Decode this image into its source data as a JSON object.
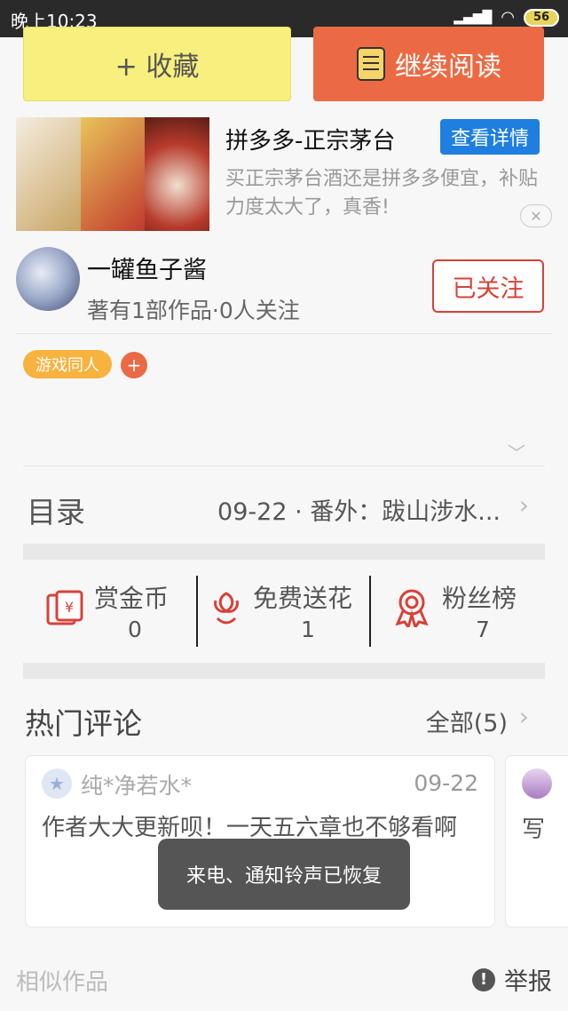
{
  "status_bar": {
    "time": "晚上10:23",
    "battery": "56"
  },
  "actions": {
    "favorite_label": "+ 收藏",
    "read_label": "继续阅读"
  },
  "ad": {
    "title": "拼多多-正宗茅台",
    "button": "查看详情",
    "description": "买正宗茅台酒还是拼多多便宜，补贴力度太大了，真香!",
    "close": "✕"
  },
  "author": {
    "name": "一罐鱼子酱",
    "meta": "著有1部作品·0人关注",
    "follow_label": "已关注"
  },
  "tags": {
    "items": [
      "游戏同人"
    ],
    "add": "+"
  },
  "toc": {
    "label": "目录",
    "latest": "09-22 · 番外：跋山涉水..."
  },
  "stats": [
    {
      "label": "赏金币",
      "value": "0",
      "icon": "coin-icon"
    },
    {
      "label": "免费送花",
      "value": "1",
      "icon": "flower-icon"
    },
    {
      "label": "粉丝榜",
      "value": "7",
      "icon": "medal-icon"
    }
  ],
  "hot_comments": {
    "title": "热门评论",
    "all_label": "全部(5)",
    "items": [
      {
        "user": "纯*净若水*",
        "date": "09-22",
        "text": "作者大大更新呗！一天五六章也不够看啊"
      },
      {
        "text": "写"
      }
    ]
  },
  "toast": "来电、通知铃声已恢复",
  "footer": {
    "similar": "相似作品",
    "report": "举报"
  },
  "colors": {
    "accent": "#ec6a43",
    "follow": "#d64238",
    "ad_button": "#1f7fe0",
    "tag": "#f8b23e"
  }
}
